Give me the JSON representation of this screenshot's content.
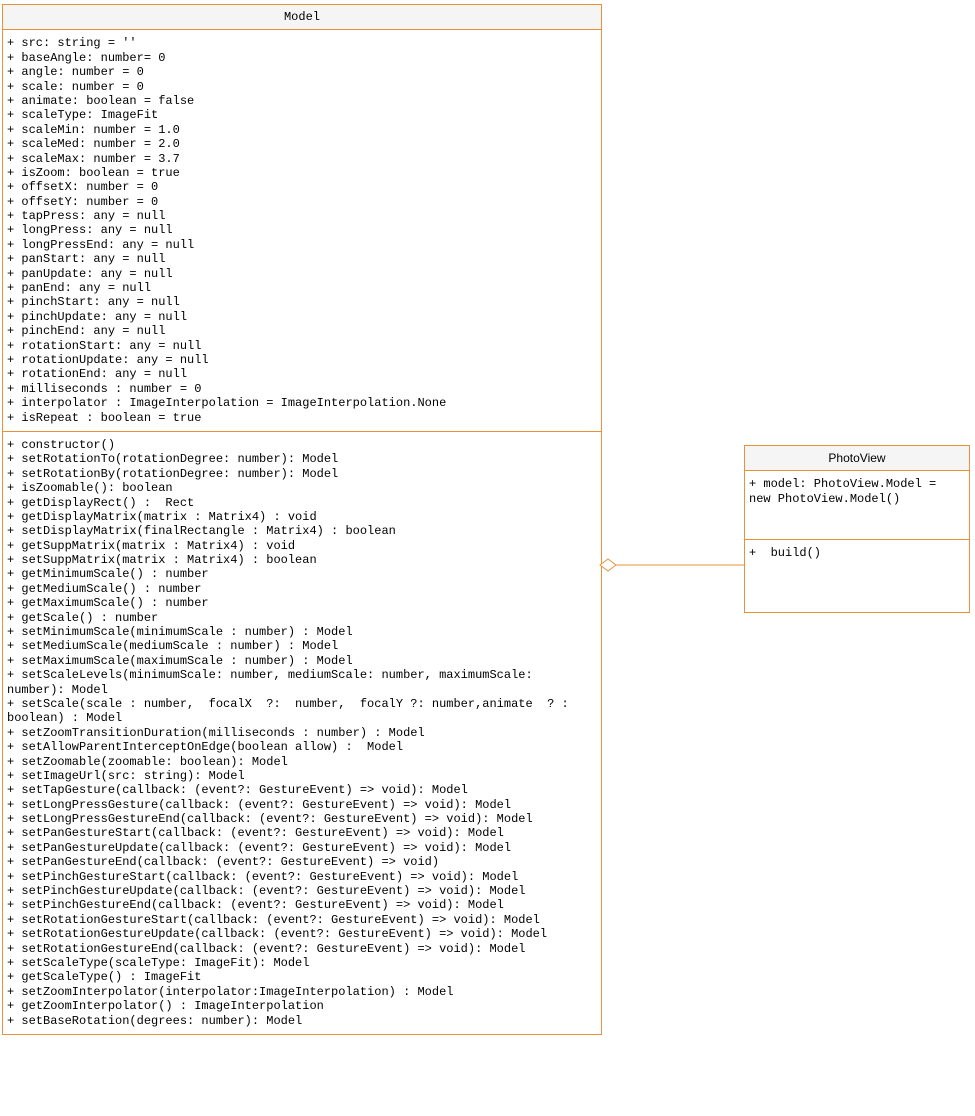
{
  "model": {
    "title": "Model",
    "attributes": [
      "+ src: string = ''",
      "+ baseAngle: number= 0",
      "+ angle: number = 0",
      "+ scale: number = 0",
      "+ animate: boolean = false",
      "+ scaleType: ImageFit",
      "+ scaleMin: number = 1.0",
      "+ scaleMed: number = 2.0",
      "+ scaleMax: number = 3.7",
      "+ isZoom: boolean = true",
      "+ offsetX: number = 0",
      "+ offsetY: number = 0",
      "+ tapPress: any = null",
      "+ longPress: any = null",
      "+ longPressEnd: any = null",
      "+ panStart: any = null",
      "+ panUpdate: any = null",
      "+ panEnd: any = null",
      "+ pinchStart: any = null",
      "+ pinchUpdate: any = null",
      "+ pinchEnd: any = null",
      "+ rotationStart: any = null",
      "+ rotationUpdate: any = null",
      "+ rotationEnd: any = null",
      "+ milliseconds : number = 0",
      "+ interpolator : ImageInterpolation = ImageInterpolation.None",
      "+ isRepeat : boolean = true"
    ],
    "methods": [
      "+ constructor()",
      "+ setRotationTo(rotationDegree: number): Model",
      "+ setRotationBy(rotationDegree: number): Model",
      "+ isZoomable(): boolean",
      "+ getDisplayRect() :  Rect",
      "+ getDisplayMatrix(matrix : Matrix4) : void",
      "+ setDisplayMatrix(finalRectangle : Matrix4) : boolean",
      "+ getSuppMatrix(matrix : Matrix4) : void",
      "+ setSuppMatrix(matrix : Matrix4) : boolean",
      "+ getMinimumScale() : number",
      "+ getMediumScale() : number",
      "+ getMaximumScale() : number",
      "+ getScale() : number",
      "+ setMinimumScale(minimumScale : number) : Model",
      "+ setMediumScale(mediumScale : number) : Model",
      "+ setMaximumScale(maximumScale : number) : Model",
      "+ setScaleLevels(minimumScale: number, mediumScale: number, maximumScale: number): Model",
      "+ setScale(scale : number,  focalX  ?:  number,  focalY ?: number,animate  ? : boolean) : Model",
      "+ setZoomTransitionDuration(milliseconds : number) : Model",
      "+ setAllowParentInterceptOnEdge(boolean allow) :  Model",
      "+ setZoomable(zoomable: boolean): Model",
      "+ setImageUrl(src: string): Model",
      "+ setTapGesture(callback: (event?: GestureEvent) => void): Model",
      "+ setLongPressGesture(callback: (event?: GestureEvent) => void): Model",
      "+ setLongPressGestureEnd(callback: (event?: GestureEvent) => void): Model",
      "+ setPanGestureStart(callback: (event?: GestureEvent) => void): Model",
      "+ setPanGestureUpdate(callback: (event?: GestureEvent) => void): Model",
      "+ setPanGestureEnd(callback: (event?: GestureEvent) => void)",
      "+ setPinchGestureStart(callback: (event?: GestureEvent) => void): Model",
      "+ setPinchGestureUpdate(callback: (event?: GestureEvent) => void): Model",
      "+ setPinchGestureEnd(callback: (event?: GestureEvent) => void): Model",
      "+ setRotationGestureStart(callback: (event?: GestureEvent) => void): Model",
      "+ setRotationGestureUpdate(callback: (event?: GestureEvent) => void): Model",
      "+ setRotationGestureEnd(callback: (event?: GestureEvent) => void): Model",
      "+ setScaleType(scaleType: ImageFit): Model",
      "+ getScaleType() : ImageFit",
      "+ setZoomInterpolator(interpolator:ImageInterpolation) : Model",
      "+ getZoomInterpolator() : ImageInterpolation",
      "+ setBaseRotation(degrees: number): Model"
    ]
  },
  "photoview": {
    "title": "PhotoView",
    "attributes": [
      "+ model: PhotoView.Model = new PhotoView.Model()"
    ],
    "methods": [
      "+  build()"
    ]
  },
  "chart_data": {
    "type": "uml-class-diagram",
    "classes": [
      {
        "name": "Model",
        "attributes_count": 27,
        "methods_count": 39
      },
      {
        "name": "PhotoView",
        "attributes_count": 1,
        "methods_count": 1
      }
    ],
    "relations": [
      {
        "from": "PhotoView",
        "to": "Model",
        "type": "aggregation"
      }
    ]
  }
}
